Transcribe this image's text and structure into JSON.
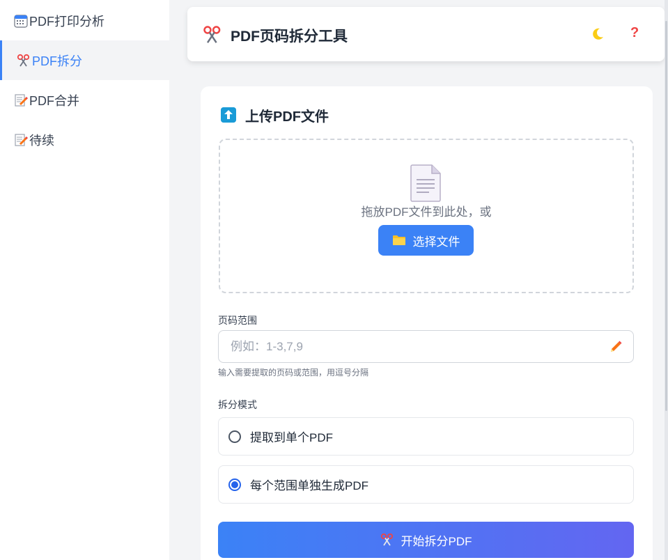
{
  "sidebar": {
    "items": [
      {
        "label": "PDF打印分析",
        "icon": "calendar-icon",
        "active": false
      },
      {
        "label": "PDF拆分",
        "icon": "scissors-icon",
        "active": true
      },
      {
        "label": "PDF合并",
        "icon": "memo-icon",
        "active": false
      },
      {
        "label": "待续",
        "icon": "memo-icon",
        "active": false
      }
    ]
  },
  "header": {
    "title": "PDF页码拆分工具",
    "icon": "scissors-icon",
    "theme_toggle_icon": "moon-icon",
    "help_label": "?"
  },
  "upload": {
    "title": "上传PDF文件",
    "icon": "upload-arrow-icon",
    "drop_text": "拖放PDF文件到此处，或",
    "choose_button": "选择文件",
    "choose_icon": "folder-icon"
  },
  "page_range": {
    "label": "页码范围",
    "placeholder": "例如：1-3,7,9",
    "value": "",
    "hint": "输入需要提取的页码或范围，用逗号分隔"
  },
  "split_mode": {
    "label": "拆分模式",
    "options": [
      {
        "label": "提取到单个PDF",
        "checked": false
      },
      {
        "label": "每个范围单独生成PDF",
        "checked": true
      }
    ]
  },
  "start_button": {
    "label": "开始拆分PDF",
    "icon": "scissors-icon"
  },
  "colors": {
    "accent": "#3b82f6",
    "accent_gradient_end": "#6366f1",
    "help": "#ef4444"
  }
}
